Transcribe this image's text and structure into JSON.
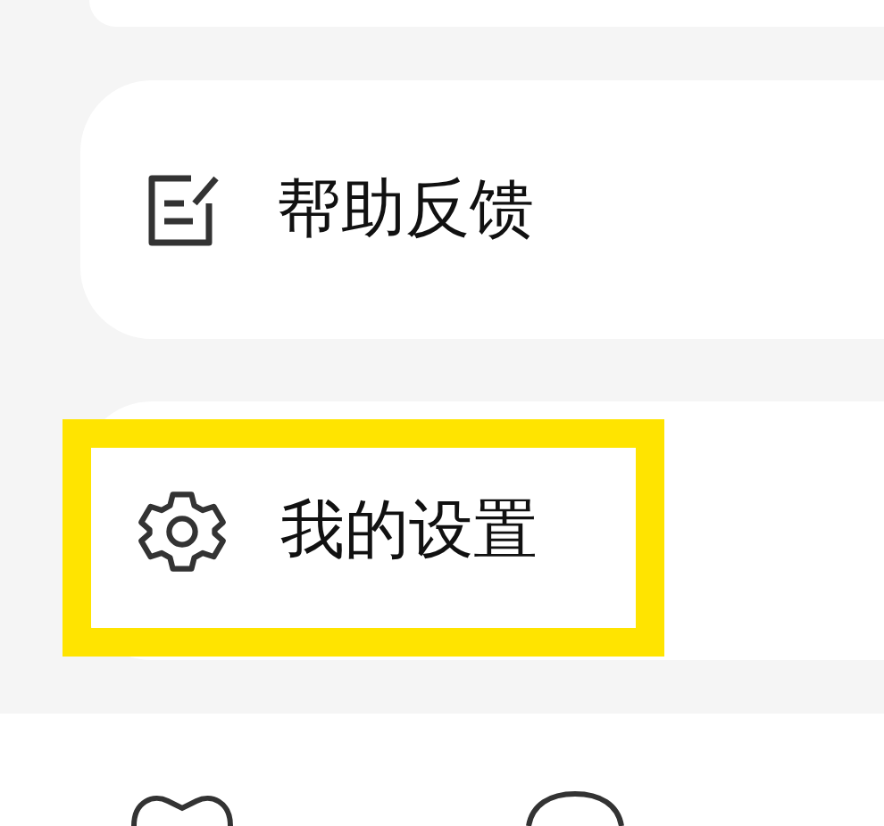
{
  "menu": [
    {
      "kind": "feedback",
      "label": "帮助反馈",
      "highlighted": false
    },
    {
      "kind": "settings",
      "label": "我的设置",
      "highlighted": true
    }
  ]
}
